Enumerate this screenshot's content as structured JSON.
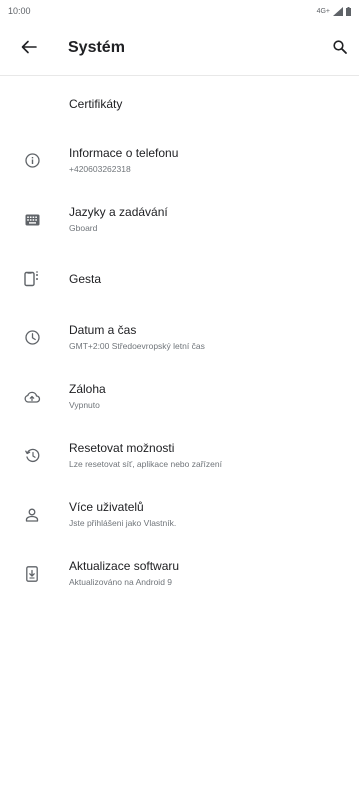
{
  "status_bar": {
    "time": "10:00",
    "network": "4G+"
  },
  "app_bar": {
    "title": "Systém"
  },
  "list": {
    "header": "Certifikáty",
    "items": [
      {
        "title": "Informace o telefonu",
        "subtitle": "+420603262318",
        "icon": "info-icon"
      },
      {
        "title": "Jazyky a zadávání",
        "subtitle": "Gboard",
        "icon": "keyboard-icon"
      },
      {
        "title": "Gesta",
        "subtitle": "",
        "icon": "gesture-icon"
      },
      {
        "title": "Datum a čas",
        "subtitle": "GMT+2:00 Středoevropský letní čas",
        "icon": "clock-icon"
      },
      {
        "title": "Záloha",
        "subtitle": "Vypnuto",
        "icon": "cloud-upload-icon"
      },
      {
        "title": "Resetovat možnosti",
        "subtitle": "Lze resetovat síť, aplikace nebo zařízení",
        "icon": "history-icon"
      },
      {
        "title": "Více uživatelů",
        "subtitle": "Jste přihlášeni jako Vlastník.",
        "icon": "person-icon"
      },
      {
        "title": "Aktualizace softwaru",
        "subtitle": "Aktualizováno na Android 9",
        "icon": "system-update-icon"
      }
    ]
  },
  "colors": {
    "background": "#ffffff",
    "text_primary": "#202124",
    "text_secondary": "#70757a",
    "icon": "#5f6368",
    "divider": "#e8e8e8"
  }
}
